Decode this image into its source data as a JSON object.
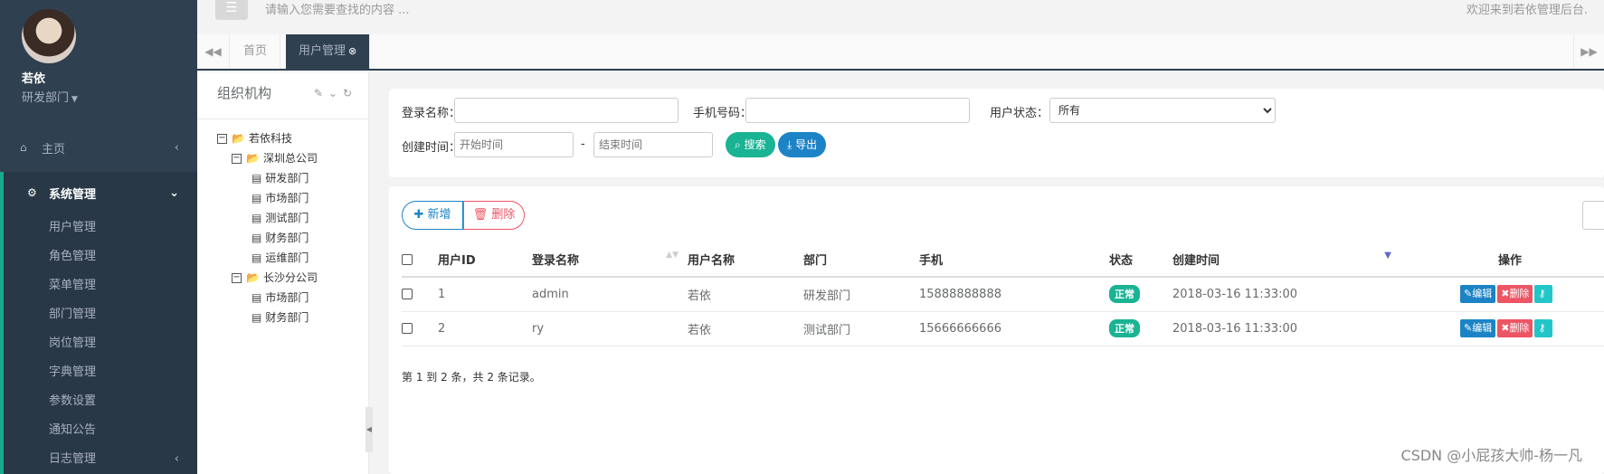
{
  "sidebar": {
    "user_name": "若依",
    "user_dept": "研发部门",
    "home_label": "主页",
    "system_label": "系统管理",
    "sub_items": [
      "用户管理",
      "角色管理",
      "菜单管理",
      "部门管理",
      "岗位管理",
      "字典管理",
      "参数设置",
      "通知公告",
      "日志管理"
    ]
  },
  "topbar": {
    "menu_icon": "☰",
    "search_placeholder": "请输入您需要查找的内容 ...",
    "welcome": "欢迎来到若依管理后台."
  },
  "tabs": {
    "home": "首页",
    "active": "用户管理"
  },
  "tree_panel": {
    "title": "组织机构",
    "root": "若依科技",
    "branch1": "深圳总公司",
    "branch1_children": [
      "研发部门",
      "市场部门",
      "测试部门",
      "财务部门",
      "运维部门"
    ],
    "branch2": "长沙分公司",
    "branch2_children": [
      "市场部门",
      "财务部门"
    ]
  },
  "search_form": {
    "login_name_label": "登录名称：",
    "login_name_value": "",
    "phone_label": "手机号码：",
    "phone_value": "",
    "status_label": "用户状态：",
    "status_value": "所有",
    "time_label": "创建时间：",
    "start_placeholder": "开始时间",
    "end_placeholder": "结束时间",
    "dash": "-",
    "search_button": "搜索",
    "export_button": "导出"
  },
  "toolbar": {
    "add_label": "新增",
    "delete_label": "删除"
  },
  "table": {
    "headers": [
      "用户ID",
      "登录名称",
      "用户名称",
      "部门",
      "手机",
      "状态",
      "创建时间",
      "操作"
    ],
    "rows": [
      {
        "id": "1",
        "login": "admin",
        "name": "若依",
        "dept": "研发部门",
        "phone": "15888888888",
        "status": "正常",
        "created": "2018-03-16 11:33:00"
      },
      {
        "id": "2",
        "login": "ry",
        "name": "若依",
        "dept": "测试部门",
        "phone": "15666666666",
        "status": "正常",
        "created": "2018-03-16 11:33:00"
      }
    ],
    "edit_label": "编辑",
    "delete_label": "删除",
    "pagination": "第 1 到 2 条，共 2 条记录。"
  },
  "watermark": "CSDN @小屁孩大帅-杨一凡",
  "colors": {
    "sidebar_bg": "#2f4050",
    "accent": "#1ab394",
    "primary": "#1c84c6",
    "danger": "#ed5565"
  }
}
